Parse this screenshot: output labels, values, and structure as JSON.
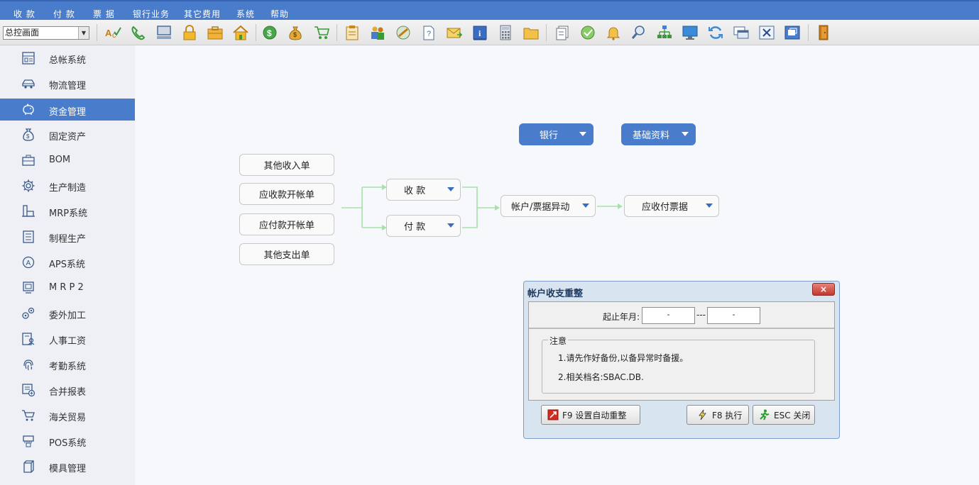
{
  "menu": [
    "收 款",
    "付 款",
    "票 据",
    "银行业务",
    "其它费用",
    "系统",
    "帮助"
  ],
  "toolbar": {
    "combo_value": "总控画面",
    "icons": [
      "spell-check-icon",
      "phone-icon",
      "computer-icon",
      "lock-icon",
      "briefcase-icon",
      "home-icon",
      "dollar-coin-icon",
      "money-bag-icon",
      "cart-icon",
      "clipboard-icon",
      "users-icon",
      "link-icon",
      "help-doc-icon",
      "mail-icon",
      "info-icon",
      "calculator-icon",
      "folder-icon",
      "documents-icon",
      "check-icon",
      "bell-icon",
      "magnifier-icon",
      "org-chart-icon",
      "monitor-icon",
      "refresh-icon",
      "windows-icon",
      "close-window-icon",
      "restore-window-icon",
      "exit-door-icon"
    ]
  },
  "sidebar": {
    "items": [
      {
        "label": "总帐系统",
        "icon": "ledger-icon"
      },
      {
        "label": "物流管理",
        "icon": "car-icon"
      },
      {
        "label": "资金管理",
        "icon": "piggy-bank-icon",
        "active": true
      },
      {
        "label": "固定资产",
        "icon": "money-bag-icon"
      },
      {
        "label": "BOM",
        "icon": "toolbox-icon"
      },
      {
        "label": "生产制造",
        "icon": "gear-icon"
      },
      {
        "label": "MRP系统",
        "icon": "factory-icon"
      },
      {
        "label": "制程生产",
        "icon": "list-icon"
      },
      {
        "label": "APS系统",
        "icon": "circle-a-icon"
      },
      {
        "label": "M R P 2",
        "icon": "monitor-icon"
      },
      {
        "label": "委外加工",
        "icon": "gears-icon"
      },
      {
        "label": "人事工资",
        "icon": "person-doc-icon"
      },
      {
        "label": "考勤系统",
        "icon": "fingerprint-icon"
      },
      {
        "label": "合并报表",
        "icon": "report-add-icon"
      },
      {
        "label": "海关贸易",
        "icon": "cart-icon"
      },
      {
        "label": "POS系统",
        "icon": "pos-icon"
      },
      {
        "label": "模具管理",
        "icon": "mold-icon"
      }
    ]
  },
  "flow": {
    "bank": "银行",
    "basic": "基础资料",
    "other_income": "其他收入单",
    "ar_open": "应收款开帐单",
    "ap_open": "应付款开帐单",
    "other_expense": "其他支出单",
    "receive": "收 款",
    "pay": "付 款",
    "account_change": "帐户/票据异动",
    "notes": "应收付票据"
  },
  "dialog": {
    "title": "帐户收支重整",
    "close": "×",
    "date_label": "起止年月:",
    "date_from": "-",
    "date_to": "-",
    "date_sep": "---",
    "notice_title": "注意",
    "notice_1": "1.请先作好备份,以备异常时备援。",
    "notice_2": "2.相关档名:SBAC.DB.",
    "btn_auto": "F9 设置自动重整",
    "btn_run": "F8 执行",
    "btn_close": "ESC 关闭"
  }
}
